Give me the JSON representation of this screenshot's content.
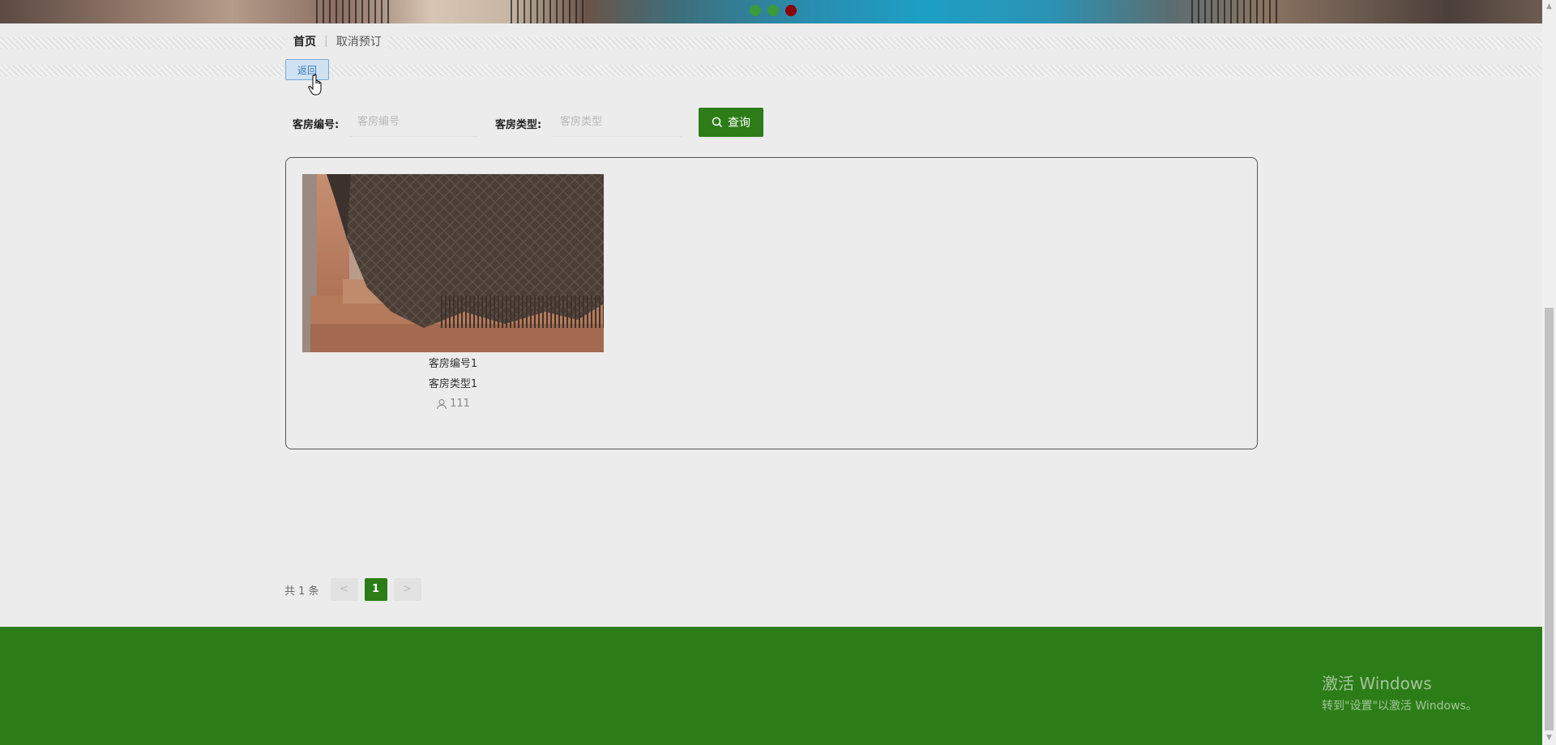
{
  "banner": {
    "dot_colors": [
      "#3a9a3a",
      "#3a9a3a",
      "#8b0000"
    ]
  },
  "breadcrumb": {
    "home": "首页",
    "separator": "|",
    "current": "取消预订"
  },
  "back_button": {
    "label": "返回"
  },
  "search": {
    "room_no_label": "客房编号:",
    "room_no_placeholder": "客房编号",
    "room_type_label": "客房类型:",
    "room_type_placeholder": "客房类型",
    "query_label": "查询"
  },
  "results": [
    {
      "room_no": "客房编号1",
      "room_type": "客房类型1",
      "views": "111",
      "image": "brown-knit-blanket-on-leather-sofa"
    }
  ],
  "pagination": {
    "total": "共 1 条",
    "prev": "<",
    "current_page": "1",
    "next": ">"
  },
  "watermark": {
    "line1": "激活 Windows",
    "line2": "转到\"设置\"以激活 Windows。"
  },
  "colors": {
    "accent": "#2c7d17",
    "back_button_bg": "#cfe2f3",
    "page_bg": "#ececec"
  }
}
